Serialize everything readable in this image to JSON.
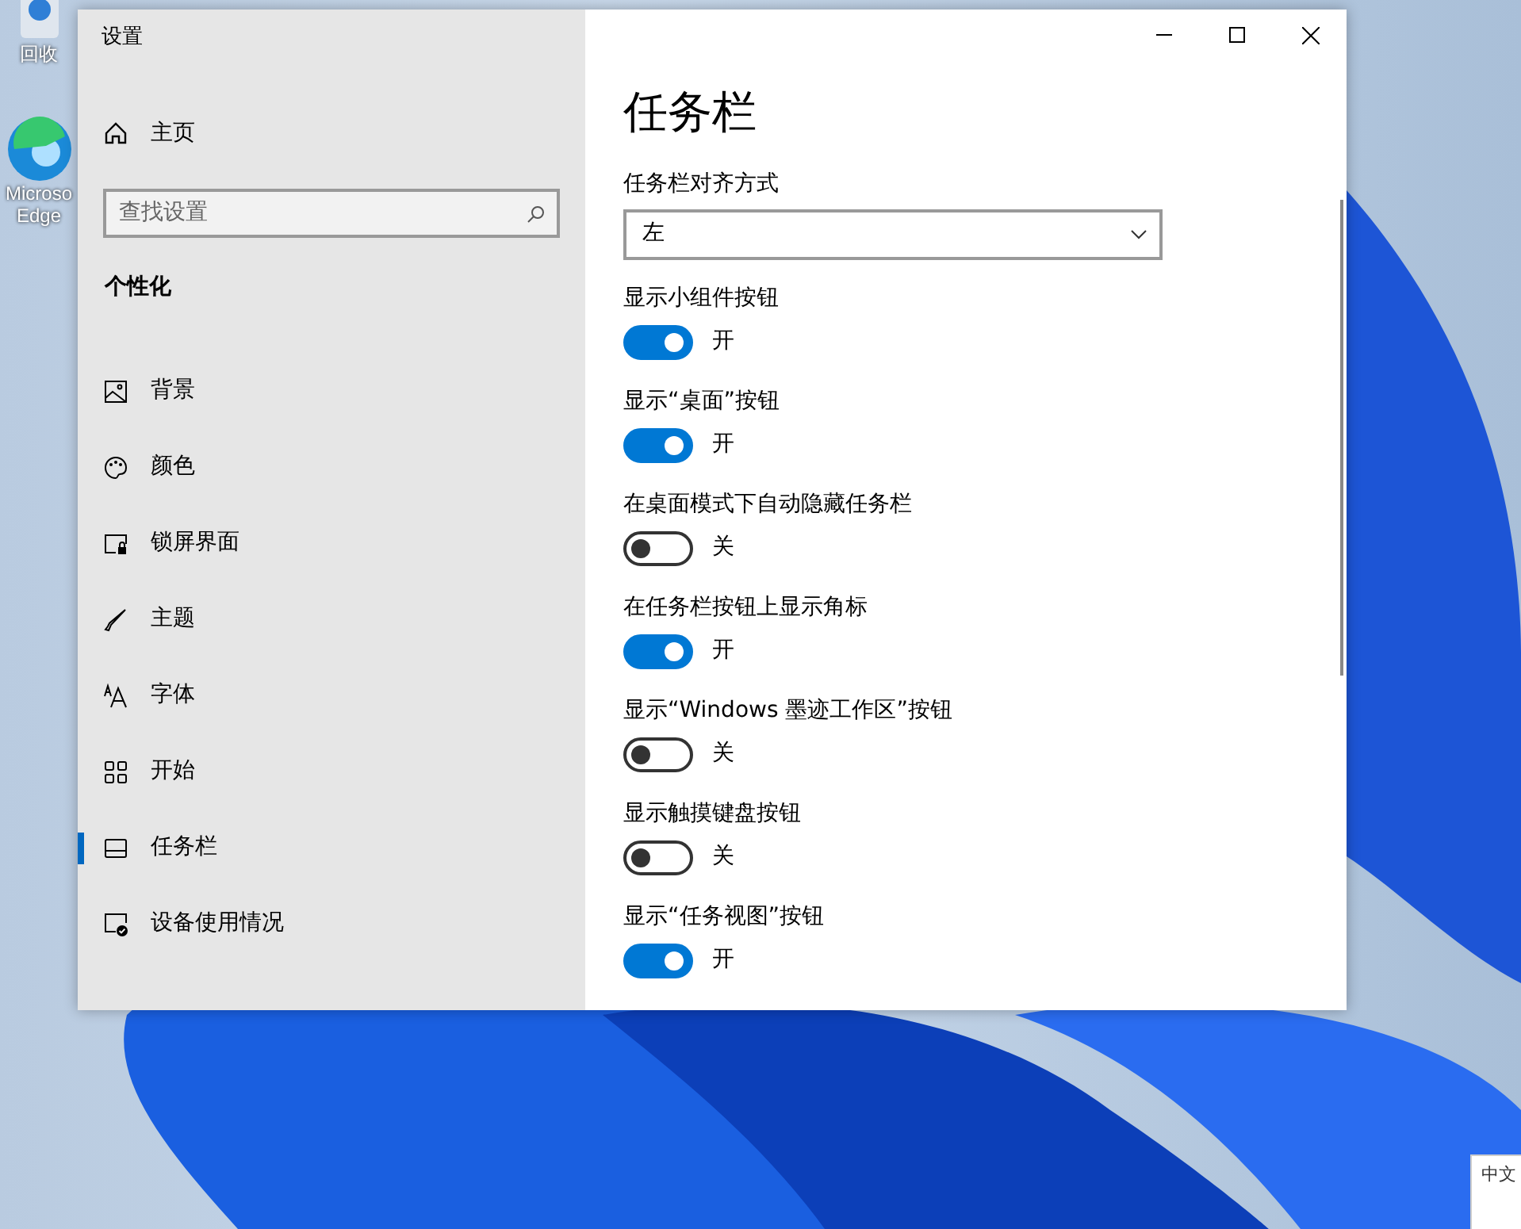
{
  "desktop": {
    "icons": [
      {
        "kind": "recycle",
        "label": "回收"
      },
      {
        "kind": "edge",
        "label": "Microso",
        "label2": "Edge"
      }
    ],
    "popup": {
      "text": "中文"
    }
  },
  "window": {
    "title": "设置"
  },
  "sidebar": {
    "home": "主页",
    "search": {
      "placeholder": "查找设置"
    },
    "section": "个性化",
    "items": [
      {
        "kind": "image",
        "label": "背景",
        "selected": false
      },
      {
        "kind": "palette",
        "label": "颜色",
        "selected": false
      },
      {
        "kind": "lock",
        "label": "锁屏界面",
        "selected": false
      },
      {
        "kind": "brush",
        "label": "主题",
        "selected": false
      },
      {
        "kind": "font",
        "label": "字体",
        "selected": false
      },
      {
        "kind": "start",
        "label": "开始",
        "selected": false
      },
      {
        "kind": "taskbar",
        "label": "任务栏",
        "selected": true
      },
      {
        "kind": "device",
        "label": "设备使用情况",
        "selected": false
      }
    ]
  },
  "content": {
    "title": "任务栏",
    "alignment": {
      "label": "任务栏对齐方式",
      "value": "左"
    },
    "settings": [
      {
        "label": "显示小组件按钮",
        "on": true,
        "state": "开"
      },
      {
        "label": "显示“桌面”按钮",
        "on": true,
        "state": "开"
      },
      {
        "label": "在桌面模式下自动隐藏任务栏",
        "on": false,
        "state": "关"
      },
      {
        "label": "在任务栏按钮上显示角标",
        "on": true,
        "state": "开"
      },
      {
        "label": "显示“Windows 墨迹工作区”按钮",
        "on": false,
        "state": "关"
      },
      {
        "label": "显示触摸键盘按钮",
        "on": false,
        "state": "关"
      },
      {
        "label": "显示“任务视图”按钮",
        "on": true,
        "state": "开"
      }
    ]
  }
}
